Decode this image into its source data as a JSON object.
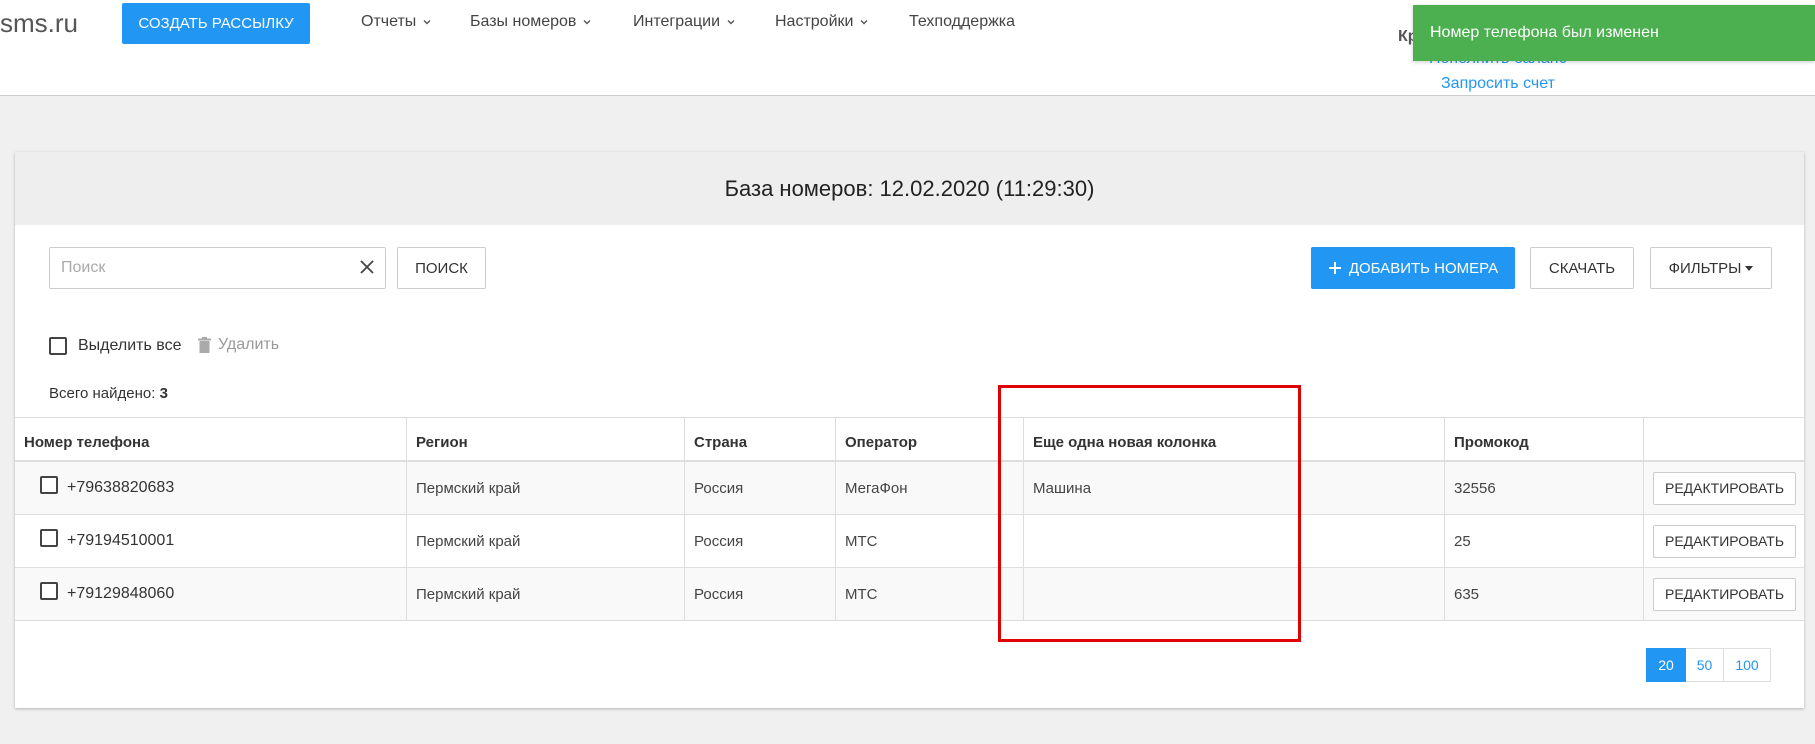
{
  "header": {
    "logo": "sms.ru",
    "create_button": "Создать рассылку",
    "nav": [
      {
        "label": "Отчеты",
        "dropdown": true
      },
      {
        "label": "Базы номеров",
        "dropdown": true
      },
      {
        "label": "Интеграции",
        "dropdown": true
      },
      {
        "label": "Настройки",
        "dropdown": true
      },
      {
        "label": "Техподдержка",
        "dropdown": false
      }
    ],
    "balance_label_partial": "Кр",
    "topup_link": "Пополнить баланс",
    "invoice_link": "Запросить счет"
  },
  "toast": {
    "message": "Номер телефона был изменен",
    "color": "#4caf50"
  },
  "card": {
    "title": "База номеров: 12.02.2020 (11:29:30)",
    "search": {
      "placeholder": "Поиск",
      "value": ""
    },
    "search_button": "Поиск",
    "add_button": "Добавить номера",
    "download_button": "Скачать",
    "filters_button": "Фильтры",
    "select_all_label": "Выделить все",
    "delete_label": "Удалить",
    "total_label": "Всего найдено:",
    "total_count": "3"
  },
  "table": {
    "columns": [
      "Номер телефона",
      "Регион",
      "Страна",
      "Оператор",
      "Еще одна новая колонка",
      "Промокод",
      ""
    ],
    "rows": [
      {
        "phone": "+79638820683",
        "region": "Пермский край",
        "country": "Россия",
        "operator": "МегаФон",
        "extra": "Машина",
        "promo": "32556",
        "action": "Редактировать"
      },
      {
        "phone": "+79194510001",
        "region": "Пермский край",
        "country": "Россия",
        "operator": "МТС",
        "extra": "",
        "promo": "25",
        "action": "Редактировать"
      },
      {
        "phone": "+79129848060",
        "region": "Пермский край",
        "country": "Россия",
        "operator": "МТС",
        "extra": "",
        "promo": "635",
        "action": "Редактировать"
      }
    ]
  },
  "pagination": {
    "options": [
      "20",
      "50",
      "100"
    ],
    "selected": "20"
  },
  "colors": {
    "primary": "#2196f3",
    "success": "#4caf50",
    "highlight_box": "#e00000"
  }
}
